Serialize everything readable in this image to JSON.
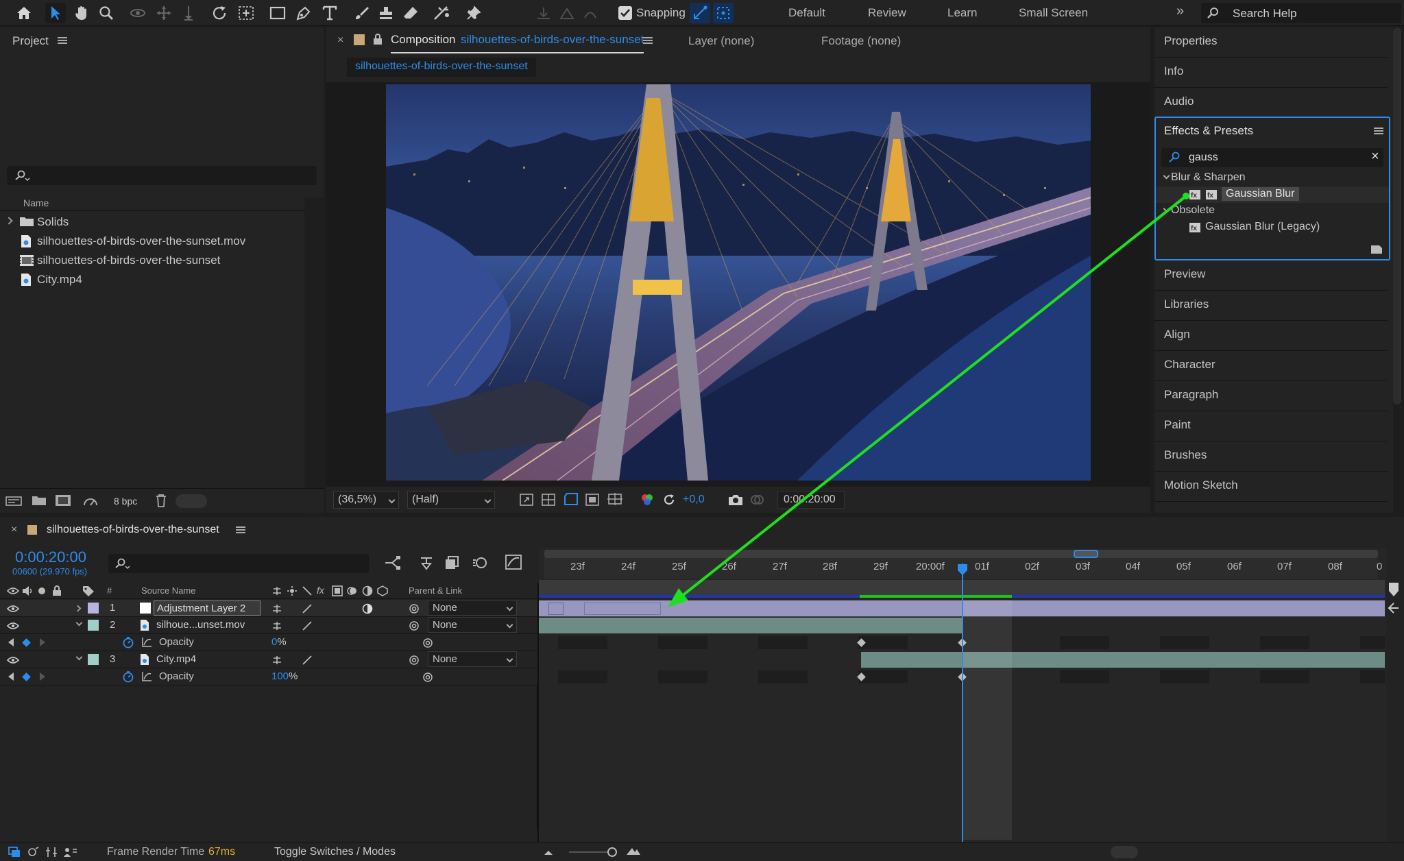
{
  "toolbar": {
    "snapping_label": "Snapping",
    "workspaces": [
      "Default",
      "Review",
      "Learn",
      "Small Screen"
    ],
    "search_placeholder": "Search Help",
    "tools": [
      "home-icon",
      "selection-tool-icon",
      "hand-tool-icon",
      "zoom-tool-icon",
      "orbit-camera-icon",
      "pan-camera-icon",
      "dolly-camera-icon",
      "rotate-tool-icon",
      "pan-behind-icon",
      "rectangle-tool-icon",
      "pen-tool-icon",
      "type-tool-icon",
      "brush-tool-icon",
      "clone-stamp-icon",
      "eraser-tool-icon",
      "roto-brush-icon",
      "puppet-pin-icon"
    ]
  },
  "project": {
    "title": "Project",
    "column_name": "Name",
    "items": [
      {
        "label": "Solids",
        "kind": "folder"
      },
      {
        "label": "silhouettes-of-birds-over-the-sunset.mov",
        "kind": "footage"
      },
      {
        "label": "silhouettes-of-birds-over-the-sunset",
        "kind": "composition"
      },
      {
        "label": "City.mp4",
        "kind": "footage"
      }
    ],
    "bpc_label": "8 bpc"
  },
  "composition": {
    "tab_prefix": "Composition",
    "tab_name": "silhouettes-of-birds-over-the-sunset",
    "layer_tab": "Layer (none)",
    "footage_tab": "Footage (none)",
    "breadcrumb": "silhouettes-of-birds-over-the-sunset",
    "zoom": "(36,5%)",
    "resolution": "(Half)",
    "exposure": "+0,0",
    "timecode": "0:00:20:00"
  },
  "right_panels": {
    "top": [
      "Properties",
      "Info",
      "Audio"
    ],
    "effects_title": "Effects & Presets",
    "search_value": "gauss",
    "tree": [
      {
        "label": "Blur & Sharpen",
        "type": "category"
      },
      {
        "label": "Gaussian Blur",
        "type": "effect",
        "selected": true
      },
      {
        "label": "Obsolete",
        "type": "category"
      },
      {
        "label": "Gaussian Blur (Legacy)",
        "type": "effect"
      }
    ],
    "bottom": [
      "Preview",
      "Libraries",
      "Align",
      "Character",
      "Paragraph",
      "Paint",
      "Brushes",
      "Motion Sketch"
    ]
  },
  "timeline": {
    "comp_tab": "silhouettes-of-birds-over-the-sunset",
    "timecode": "0:00:20:00",
    "frame_info": "00600 (29.970 fps)",
    "columns": {
      "num": "#",
      "source": "Source Name",
      "parent": "Parent & Link"
    },
    "layers": [
      {
        "num": "1",
        "name": "Adjustment Layer 2",
        "parent": "None",
        "color": "#b7b4df"
      },
      {
        "num": "2",
        "name": "silhoue...unset.mov",
        "parent": "None",
        "color": "#9fd0c8"
      },
      {
        "num": "3",
        "name": "City.mp4",
        "parent": "None",
        "color": "#9fd0c8"
      }
    ],
    "props": [
      {
        "name": "Opacity",
        "value": "0",
        "unit": "%"
      },
      {
        "name": "Opacity",
        "value": "100",
        "unit": "%"
      }
    ],
    "ruler": [
      "23f",
      "24f",
      "25f",
      "26f",
      "27f",
      "28f",
      "29f",
      "20:00f",
      "01f",
      "02f",
      "03f",
      "04f",
      "05f",
      "06f",
      "07f",
      "08f",
      "0"
    ],
    "footer": {
      "render_label": "Frame Render Time",
      "render_value": "67ms",
      "toggle_label": "Toggle Switches / Modes"
    }
  },
  "colors": {
    "accent": "#2d8ceb",
    "annotation_arrow": "#1fe01f",
    "work_area": "#2235a8"
  }
}
